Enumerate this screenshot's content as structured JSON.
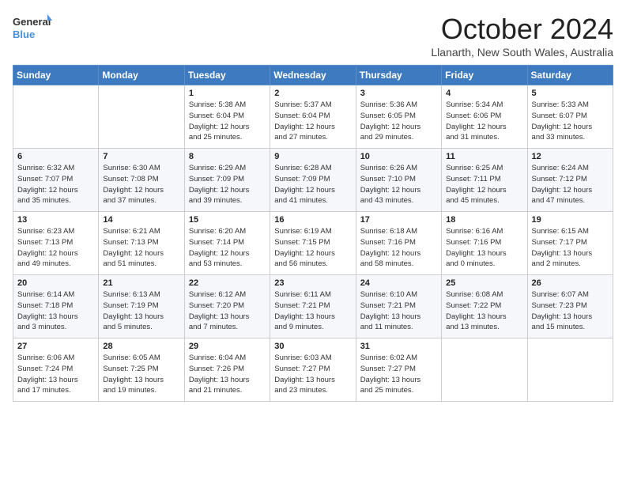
{
  "logo": {
    "line1": "General",
    "line2": "Blue"
  },
  "title": "October 2024",
  "location": "Llanarth, New South Wales, Australia",
  "weekdays": [
    "Sunday",
    "Monday",
    "Tuesday",
    "Wednesday",
    "Thursday",
    "Friday",
    "Saturday"
  ],
  "weeks": [
    [
      {
        "day": "",
        "info": ""
      },
      {
        "day": "",
        "info": ""
      },
      {
        "day": "1",
        "info": "Sunrise: 5:38 AM\nSunset: 6:04 PM\nDaylight: 12 hours\nand 25 minutes."
      },
      {
        "day": "2",
        "info": "Sunrise: 5:37 AM\nSunset: 6:04 PM\nDaylight: 12 hours\nand 27 minutes."
      },
      {
        "day": "3",
        "info": "Sunrise: 5:36 AM\nSunset: 6:05 PM\nDaylight: 12 hours\nand 29 minutes."
      },
      {
        "day": "4",
        "info": "Sunrise: 5:34 AM\nSunset: 6:06 PM\nDaylight: 12 hours\nand 31 minutes."
      },
      {
        "day": "5",
        "info": "Sunrise: 5:33 AM\nSunset: 6:07 PM\nDaylight: 12 hours\nand 33 minutes."
      }
    ],
    [
      {
        "day": "6",
        "info": "Sunrise: 6:32 AM\nSunset: 7:07 PM\nDaylight: 12 hours\nand 35 minutes."
      },
      {
        "day": "7",
        "info": "Sunrise: 6:30 AM\nSunset: 7:08 PM\nDaylight: 12 hours\nand 37 minutes."
      },
      {
        "day": "8",
        "info": "Sunrise: 6:29 AM\nSunset: 7:09 PM\nDaylight: 12 hours\nand 39 minutes."
      },
      {
        "day": "9",
        "info": "Sunrise: 6:28 AM\nSunset: 7:09 PM\nDaylight: 12 hours\nand 41 minutes."
      },
      {
        "day": "10",
        "info": "Sunrise: 6:26 AM\nSunset: 7:10 PM\nDaylight: 12 hours\nand 43 minutes."
      },
      {
        "day": "11",
        "info": "Sunrise: 6:25 AM\nSunset: 7:11 PM\nDaylight: 12 hours\nand 45 minutes."
      },
      {
        "day": "12",
        "info": "Sunrise: 6:24 AM\nSunset: 7:12 PM\nDaylight: 12 hours\nand 47 minutes."
      }
    ],
    [
      {
        "day": "13",
        "info": "Sunrise: 6:23 AM\nSunset: 7:13 PM\nDaylight: 12 hours\nand 49 minutes."
      },
      {
        "day": "14",
        "info": "Sunrise: 6:21 AM\nSunset: 7:13 PM\nDaylight: 12 hours\nand 51 minutes."
      },
      {
        "day": "15",
        "info": "Sunrise: 6:20 AM\nSunset: 7:14 PM\nDaylight: 12 hours\nand 53 minutes."
      },
      {
        "day": "16",
        "info": "Sunrise: 6:19 AM\nSunset: 7:15 PM\nDaylight: 12 hours\nand 56 minutes."
      },
      {
        "day": "17",
        "info": "Sunrise: 6:18 AM\nSunset: 7:16 PM\nDaylight: 12 hours\nand 58 minutes."
      },
      {
        "day": "18",
        "info": "Sunrise: 6:16 AM\nSunset: 7:16 PM\nDaylight: 13 hours\nand 0 minutes."
      },
      {
        "day": "19",
        "info": "Sunrise: 6:15 AM\nSunset: 7:17 PM\nDaylight: 13 hours\nand 2 minutes."
      }
    ],
    [
      {
        "day": "20",
        "info": "Sunrise: 6:14 AM\nSunset: 7:18 PM\nDaylight: 13 hours\nand 3 minutes."
      },
      {
        "day": "21",
        "info": "Sunrise: 6:13 AM\nSunset: 7:19 PM\nDaylight: 13 hours\nand 5 minutes."
      },
      {
        "day": "22",
        "info": "Sunrise: 6:12 AM\nSunset: 7:20 PM\nDaylight: 13 hours\nand 7 minutes."
      },
      {
        "day": "23",
        "info": "Sunrise: 6:11 AM\nSunset: 7:21 PM\nDaylight: 13 hours\nand 9 minutes."
      },
      {
        "day": "24",
        "info": "Sunrise: 6:10 AM\nSunset: 7:21 PM\nDaylight: 13 hours\nand 11 minutes."
      },
      {
        "day": "25",
        "info": "Sunrise: 6:08 AM\nSunset: 7:22 PM\nDaylight: 13 hours\nand 13 minutes."
      },
      {
        "day": "26",
        "info": "Sunrise: 6:07 AM\nSunset: 7:23 PM\nDaylight: 13 hours\nand 15 minutes."
      }
    ],
    [
      {
        "day": "27",
        "info": "Sunrise: 6:06 AM\nSunset: 7:24 PM\nDaylight: 13 hours\nand 17 minutes."
      },
      {
        "day": "28",
        "info": "Sunrise: 6:05 AM\nSunset: 7:25 PM\nDaylight: 13 hours\nand 19 minutes."
      },
      {
        "day": "29",
        "info": "Sunrise: 6:04 AM\nSunset: 7:26 PM\nDaylight: 13 hours\nand 21 minutes."
      },
      {
        "day": "30",
        "info": "Sunrise: 6:03 AM\nSunset: 7:27 PM\nDaylight: 13 hours\nand 23 minutes."
      },
      {
        "day": "31",
        "info": "Sunrise: 6:02 AM\nSunset: 7:27 PM\nDaylight: 13 hours\nand 25 minutes."
      },
      {
        "day": "",
        "info": ""
      },
      {
        "day": "",
        "info": ""
      }
    ]
  ]
}
